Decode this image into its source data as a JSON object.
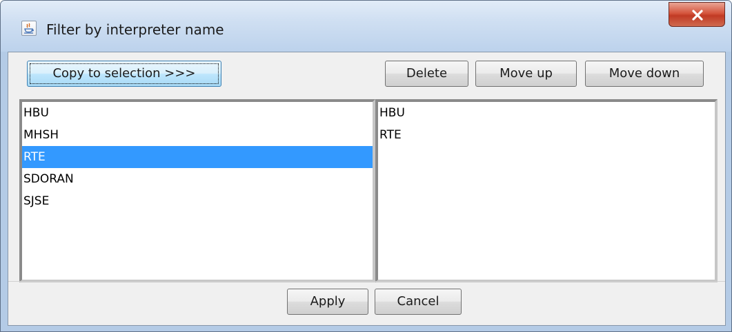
{
  "window": {
    "title": "Filter by interpreter name",
    "close_label": "x"
  },
  "toolbar": {
    "copy_label": "Copy to selection >>>",
    "delete_label": "Delete",
    "move_up_label": "Move up",
    "move_down_label": "Move down"
  },
  "available_list": {
    "items": [
      "HBU",
      "MHSH",
      "RTE",
      "SDORAN",
      "SJSE"
    ],
    "selected_index": 2
  },
  "selected_list": {
    "items": [
      "HBU",
      "RTE"
    ]
  },
  "footer": {
    "apply_label": "Apply",
    "cancel_label": "Cancel"
  },
  "colors": {
    "selection": "#3399ff",
    "title_bar": "#cfdff2",
    "close_button": "#c13a24"
  }
}
